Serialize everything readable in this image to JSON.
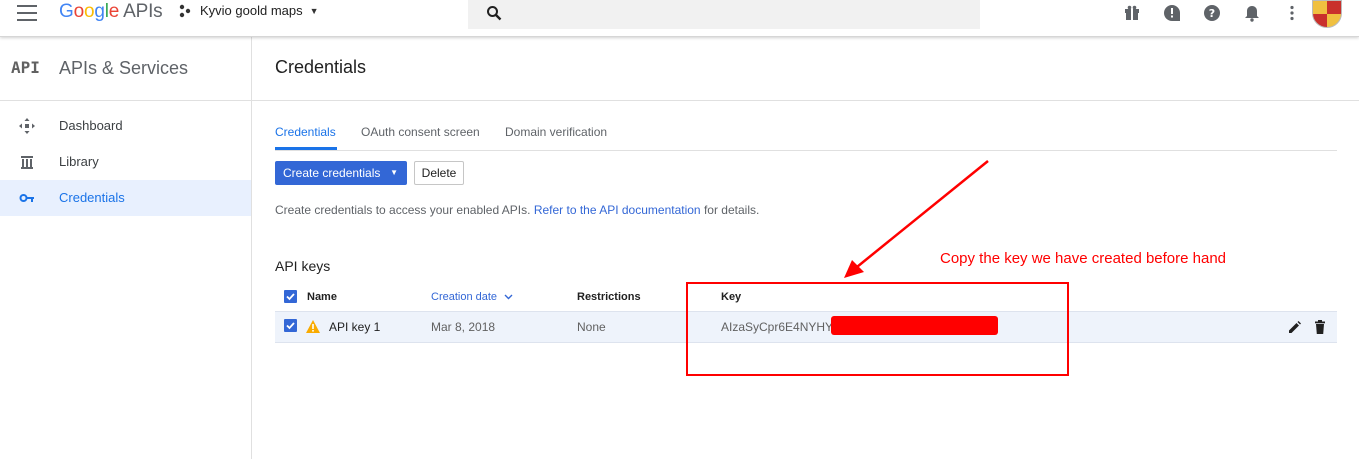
{
  "app": {
    "logo_g": "G",
    "logo_o1": "o",
    "logo_o2": "o",
    "logo_g2": "g",
    "logo_l": "l",
    "logo_e": "e",
    "logo_suffix": "APIs",
    "project_name": "Kyvio goold maps"
  },
  "sidebar": {
    "badge": "API",
    "title": "APIs & Services",
    "items": [
      {
        "label": "Dashboard",
        "icon": "dashboard-icon"
      },
      {
        "label": "Library",
        "icon": "library-icon"
      },
      {
        "label": "Credentials",
        "icon": "key-icon",
        "active": true
      }
    ]
  },
  "main": {
    "title": "Credentials",
    "tabs": [
      {
        "label": "Credentials",
        "active": true
      },
      {
        "label": "OAuth consent screen"
      },
      {
        "label": "Domain verification"
      }
    ],
    "create_button": "Create credentials",
    "delete_button": "Delete",
    "hint_text": "Create credentials to access your enabled APIs.",
    "hint_link": "Refer to the API documentation",
    "hint_suffix": "for details.",
    "section_title": "API keys"
  },
  "table": {
    "headers": {
      "name": "Name",
      "creation_date": "Creation date",
      "restrictions": "Restrictions",
      "key": "Key"
    },
    "rows": [
      {
        "name": "API key 1",
        "creation_date": "Mar 8, 2018",
        "restrictions": "None",
        "key": "AIzaSyCpr6E4NYHY"
      }
    ]
  },
  "annotation": {
    "text": "Copy the key we have created before hand",
    "color": "#ff0000"
  },
  "colors": {
    "accent": "#3367d6",
    "active_bg": "#e8f0fe",
    "warning": "#f9ab00"
  }
}
